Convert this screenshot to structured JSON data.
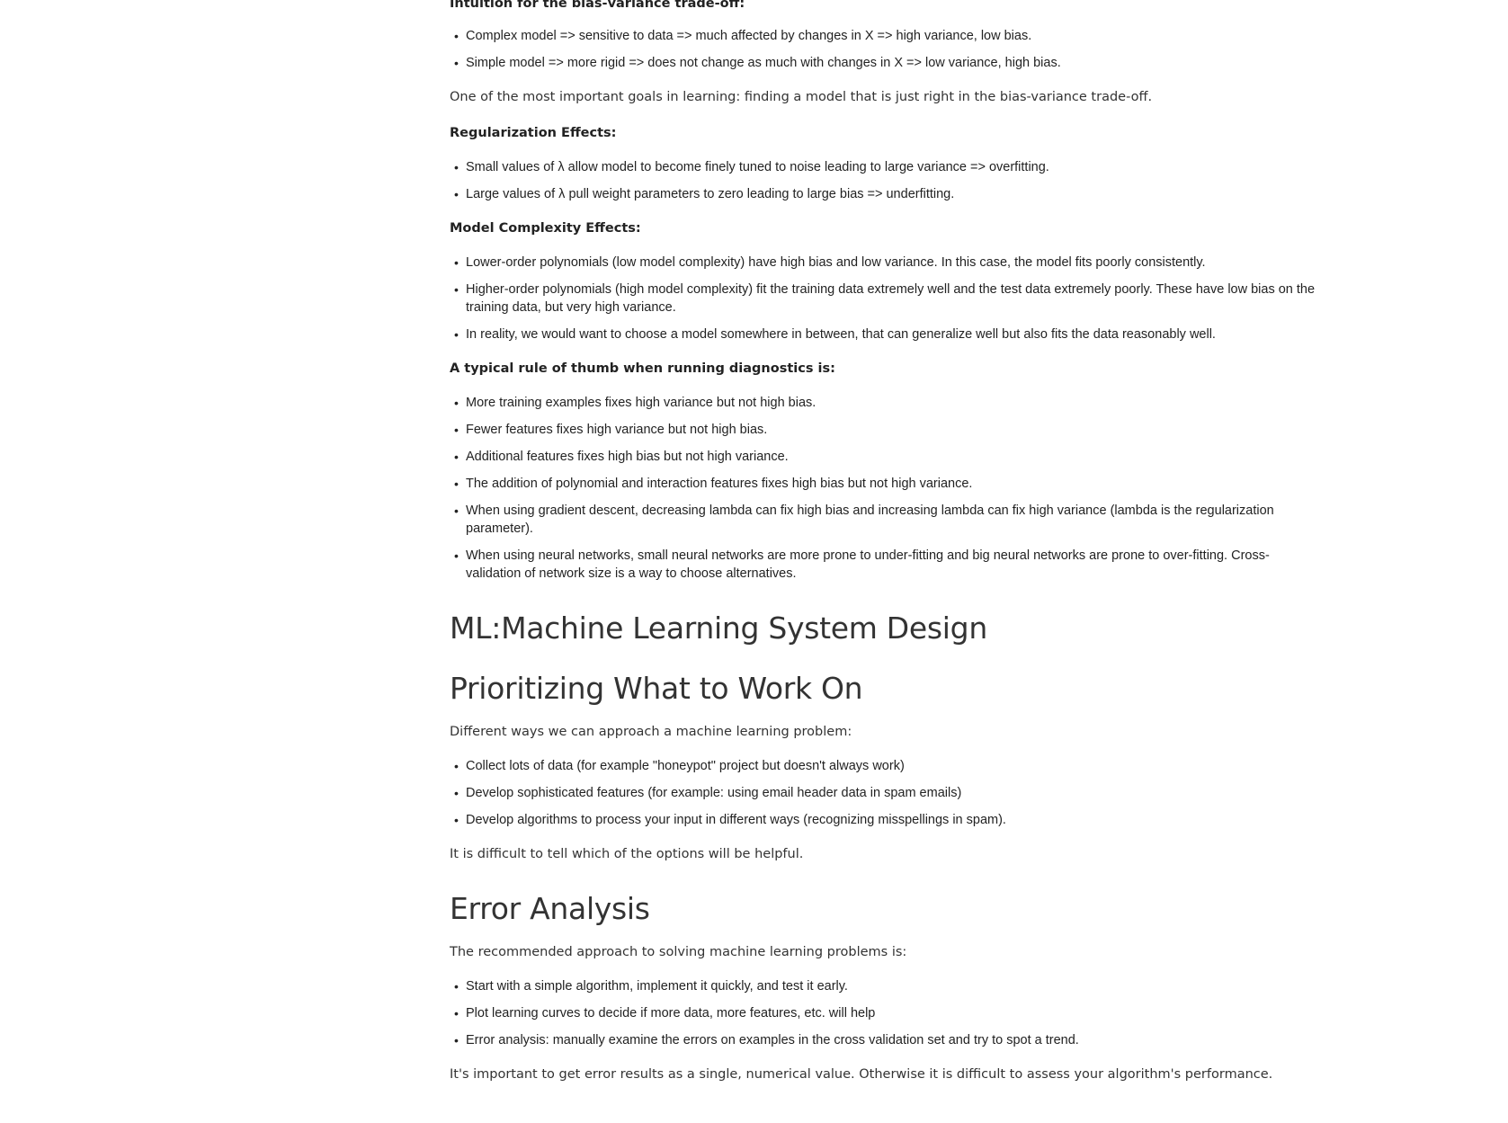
{
  "sections": {
    "bias_variance": {
      "heading": "Intuition for the bias-variance trade-off:",
      "items": [
        "Complex model => sensitive to data => much affected by changes in X => high variance, low bias.",
        "Simple model => more rigid => does not change as much with changes in X => low variance, high bias."
      ],
      "note": "One of the most important goals in learning: finding a model that is just right in the bias-variance trade-off."
    },
    "regularization": {
      "heading": "Regularization Effects:",
      "items": [
        "Small values of λ allow model to become finely tuned to noise leading to large variance => overfitting.",
        "Large values of λ pull weight parameters to zero leading to large bias => underfitting."
      ]
    },
    "complexity": {
      "heading": "Model Complexity Effects:",
      "items": [
        "Lower-order polynomials (low model complexity) have high bias and low variance. In this case, the model fits poorly consistently.",
        "Higher-order polynomials (high model complexity) fit the training data extremely well and the test data extremely poorly. These have low bias on the training data, but very high variance.",
        "In reality, we would want to choose a model somewhere in between, that can generalize well but also fits the data reasonably well."
      ]
    },
    "rule_of_thumb": {
      "heading": "A typical rule of thumb when running diagnostics is:",
      "items": [
        "More training examples fixes high variance but not high bias.",
        "Fewer features fixes high variance but not high bias.",
        "Additional features fixes high bias but not high variance.",
        "The addition of polynomial and interaction features fixes high bias but not high variance.",
        "When using gradient descent, decreasing lambda can fix high bias and increasing lambda can fix high variance (lambda is the regularization parameter).",
        "When using neural networks, small neural networks are more prone to under-fitting and big neural networks are prone to over-fitting. Cross-validation of network size is a way to choose alternatives."
      ]
    },
    "system_design": {
      "title": "ML:Machine Learning System Design"
    },
    "prioritizing": {
      "title": "Prioritizing What to Work On",
      "intro": "Different ways we can approach a machine learning problem:",
      "items": [
        "Collect lots of data (for example \"honeypot\" project but doesn't always work)",
        "Develop sophisticated features (for example: using email header data in spam emails)",
        "Develop algorithms to process your input in different ways (recognizing misspellings in spam)."
      ],
      "note": "It is difficult to tell which of the options will be helpful."
    },
    "error_analysis": {
      "title": "Error Analysis",
      "intro": "The recommended approach to solving machine learning problems is:",
      "items": [
        "Start with a simple algorithm, implement it quickly, and test it early.",
        "Plot learning curves to decide if more data, more features, etc. will help",
        "Error analysis: manually examine the errors on examples in the cross validation set and try to spot a trend."
      ],
      "note": "It's important to get error results as a single, numerical value. Otherwise it is difficult to assess your algorithm's performance."
    }
  }
}
